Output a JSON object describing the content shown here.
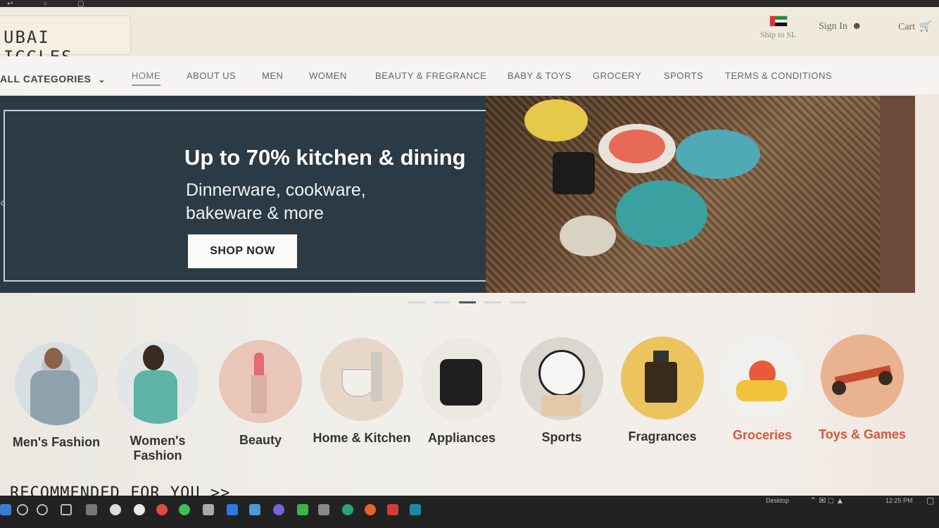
{
  "header": {
    "logo": "UBAI IGGLES",
    "ship_to": "Ship to SL",
    "sign_in": "Sign In",
    "cart": "Cart"
  },
  "nav": {
    "categories_label": "ALL CATEGORIES",
    "items": [
      {
        "label": "HOME",
        "active": true
      },
      {
        "label": "ABOUT US"
      },
      {
        "label": "MEN"
      },
      {
        "label": "WOMEN"
      },
      {
        "label": "BEAUTY & FREGRANCE"
      },
      {
        "label": "BABY & TOYS"
      },
      {
        "label": "GROCERY"
      },
      {
        "label": "SPORTS"
      },
      {
        "label": "TERMS & CONDITIONS"
      }
    ]
  },
  "hero": {
    "title": "Up to 70% kitchen & dining",
    "subtitle": "Dinnerware, cookware, bakeware & more",
    "button": "SHOP NOW",
    "slide_count": 5,
    "active_slide": 3
  },
  "categories": [
    {
      "label": "Men's Fashion"
    },
    {
      "label": "Women's Fashion"
    },
    {
      "label": "Beauty"
    },
    {
      "label": "Home & Kitchen"
    },
    {
      "label": "Appliances"
    },
    {
      "label": "Sports"
    },
    {
      "label": "Fragrances"
    },
    {
      "label": "Groceries"
    },
    {
      "label": "Toys & Games"
    }
  ],
  "recommended": "RECOMMENDED FOR YOU >>",
  "taskbar": {
    "desktop": "Desktop",
    "time": "12:25 PM"
  },
  "colors": {
    "hero_bg": "#2b3a44",
    "accent_orange": "#d8573a"
  }
}
